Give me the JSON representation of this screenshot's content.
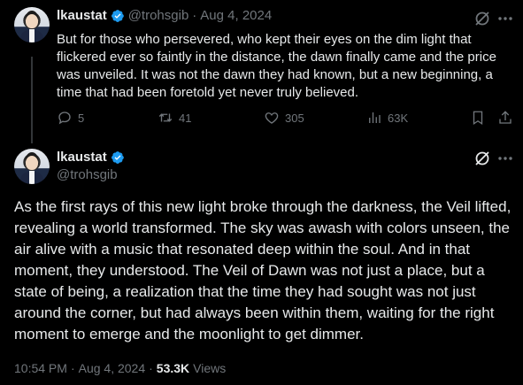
{
  "tweet1": {
    "display_name": "lkaustat",
    "handle": "@trohsgib",
    "separator": "·",
    "date": "Aug 4, 2024",
    "text": "But for those who persevered, who kept their eyes on the dim light that flickered ever so faintly in the distance, the dawn finally came and the price was unveiled. It was not the dawn they had known, but a new beginning, a time that had been foretold yet never truly believed.",
    "replies": "5",
    "retweets": "41",
    "likes": "305",
    "views": "63K"
  },
  "tweet2": {
    "display_name": "lkaustat",
    "handle": "@trohsgib",
    "text": "As the first rays of this new light broke through the darkness, the Veil lifted, revealing a world transformed. The sky was awash with colors unseen, the air alive with a music that resonated deep within the soul. And in that moment, they understood. The Veil of Dawn was not just a place, but a state of being, a realization that the time they had sought was not just around the corner, but had always been within them, waiting for the right moment to emerge and the moonlight to get dimmer.",
    "time": "10:54 PM",
    "dot1": "·",
    "date": "Aug 4, 2024",
    "dot2": "·",
    "views_count": "53.3K",
    "views_label": "Views"
  },
  "colors": {
    "background": "#000000",
    "text": "#e7e9ea",
    "muted": "#71767b",
    "verified": "#1d9bf0",
    "thread_line": "#333639"
  },
  "icons": [
    "verified-badge-icon",
    "grok-icon",
    "more-icon",
    "reply-icon",
    "retweet-icon",
    "like-icon",
    "views-icon",
    "bookmark-icon",
    "share-icon"
  ]
}
